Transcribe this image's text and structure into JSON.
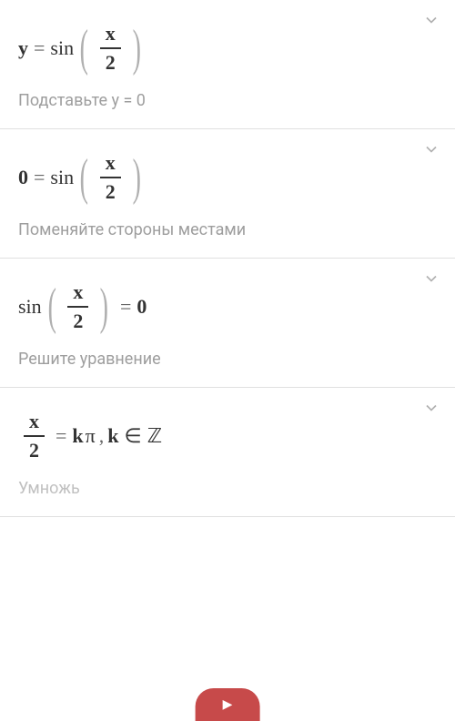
{
  "steps": [
    {
      "equation": {
        "lhs": "y",
        "rhs_fn": "sin",
        "frac_num": "x",
        "frac_den": "2"
      },
      "instruction": "Подставьте y = 0"
    },
    {
      "equation": {
        "lhs": "0",
        "rhs_fn": "sin",
        "frac_num": "x",
        "frac_den": "2"
      },
      "instruction": "Поменяйте стороны местами"
    },
    {
      "equation": {
        "lhs_fn": "sin",
        "frac_num": "x",
        "frac_den": "2",
        "rhs": "0"
      },
      "instruction": "Решите уравнение"
    },
    {
      "equation": {
        "frac_num": "x",
        "frac_den": "2",
        "rhs_k": "k",
        "rhs_pi": "π",
        "cond_k": "k",
        "cond_in": "∈",
        "cond_set": "ℤ"
      },
      "instruction": "Умножь"
    }
  ],
  "bottom_button": "▶"
}
